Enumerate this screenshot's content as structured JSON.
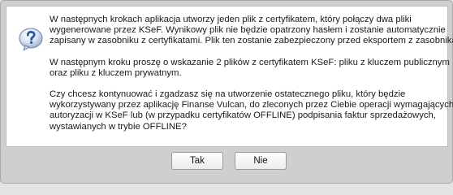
{
  "dialog": {
    "icon": "question-icon",
    "paragraphs": [
      [
        "W następnych krokach aplikacja utworzy jeden plik z certyfikatem, który połączy dwa pliki",
        "wygenerowane przez KSeF. Wynikowy plik nie będzie opatrzony hasłem i zostanie automatycznie",
        "zapisany w zasobniku z certyfikatami. Plik ten zostanie zabezpieczony przed eksportem z zasobnika."
      ],
      [
        "W następnym kroku proszę o wskazanie 2 plików z certyfikatem KSeF: pliku z kluczem publicznym",
        "oraz pliku z kluczem prywatnym."
      ],
      [
        "Czy chcesz kontynuować i zgadzasz się na utworzenie ostatecznego pliku, który będzie",
        "wykorzystywany przez aplikację Finanse Vulcan, do zleconych przez Ciebie operacji wymagających",
        "autoryzacji w KSeF lub (w przypadku certyfikatów OFFLINE) podpisania faktur sprzedażowych,",
        "wystawianych w trybie OFFLINE?"
      ]
    ],
    "buttons": {
      "yes_label": "Tak",
      "no_label": "Nie"
    }
  }
}
